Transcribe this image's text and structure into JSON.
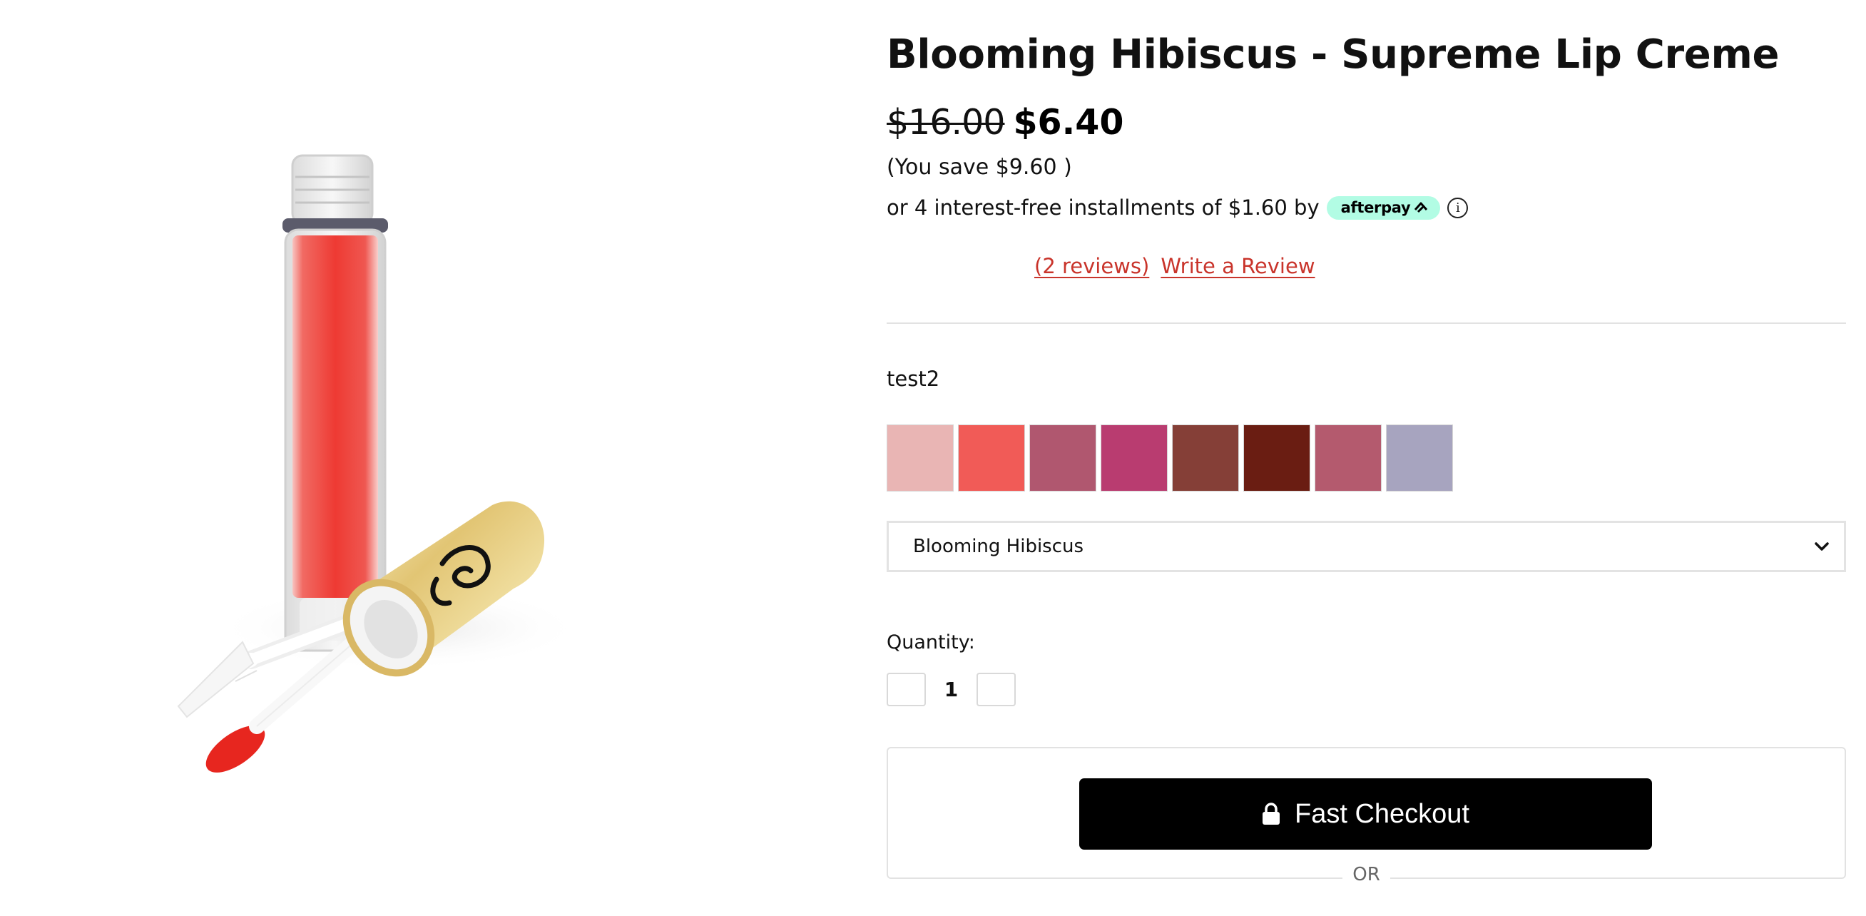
{
  "product": {
    "title": "Blooming Hibiscus - Supreme Lip Creme",
    "price_original": "$16.00",
    "price_sale": "$6.40",
    "savings": "(You save $9.60 )",
    "installments_text": "or 4 interest-free installments of $1.60 by",
    "afterpay_label": "afterpay",
    "info_glyph": "i"
  },
  "reviews": {
    "count_link": "(2 reviews)",
    "write_link": "Write a Review",
    "link_color": "#c9342b"
  },
  "variant": {
    "option_label": "test2",
    "swatches": [
      {
        "name": "swatch-1",
        "color": "#e9b5b4"
      },
      {
        "name": "swatch-2",
        "color": "#f15b57"
      },
      {
        "name": "swatch-3",
        "color": "#b0576f"
      },
      {
        "name": "swatch-4",
        "color": "#b93c70"
      },
      {
        "name": "swatch-5",
        "color": "#853f37"
      },
      {
        "name": "swatch-6",
        "color": "#6a1d12"
      },
      {
        "name": "swatch-7",
        "color": "#b45a6e"
      },
      {
        "name": "swatch-8",
        "color": "#a7a4bf"
      }
    ],
    "selected_shade": "Blooming Hibiscus"
  },
  "quantity": {
    "label": "Quantity:",
    "value": "1"
  },
  "checkout": {
    "button_label": "Fast Checkout",
    "or_label": "OR",
    "lock_icon": "lock-icon"
  },
  "colors": {
    "afterpay_mint": "#b2fce4",
    "button_bg": "#000000",
    "lip_red": "#ee3a33",
    "cap_gold": "#e3c877"
  }
}
